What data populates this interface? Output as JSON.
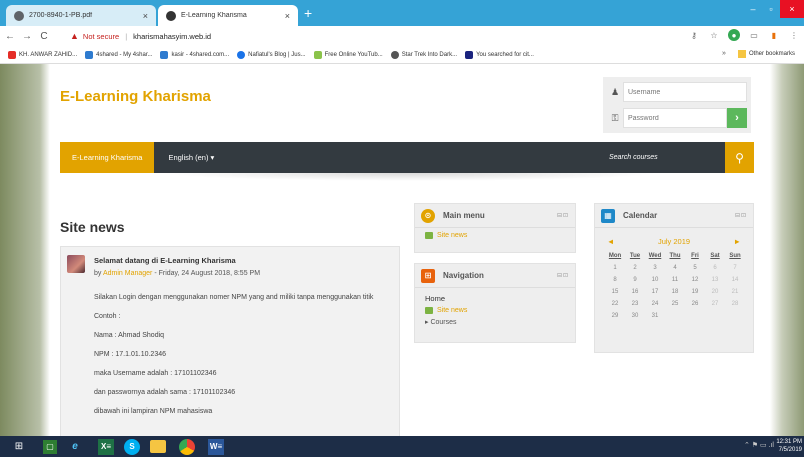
{
  "browser": {
    "tabs": [
      {
        "label": "2700-8940-1-PB.pdf",
        "close": "×"
      },
      {
        "label": "E-Learning Kharisma",
        "close": "×"
      }
    ],
    "new_tab": "+",
    "window": {
      "minimize": "–",
      "maximize": "▫",
      "close": "×"
    },
    "nav": {
      "back": "←",
      "forward": "→",
      "reload": "C"
    },
    "address": {
      "security": "Not secure",
      "separator": "|",
      "url": "kharismahasyim.web.id"
    },
    "bookmarks": [
      {
        "label": "KH. ANWAR ZAHID..."
      },
      {
        "label": "4shared - My 4shar..."
      },
      {
        "label": "kasir - 4shared.com..."
      },
      {
        "label": "Nafiatul's Blog | Jus..."
      },
      {
        "label": "Free Online YouTub..."
      },
      {
        "label": "Star Trek Into Dark..."
      },
      {
        "label": "You searched for cit..."
      }
    ],
    "bookmarks_more": "»",
    "other_bookmarks": "Other bookmarks"
  },
  "site": {
    "name": "E-Learning Kharisma",
    "login": {
      "username_placeholder": "Username",
      "password_placeholder": "Password",
      "go": "›"
    },
    "nav": {
      "home": "E-Learning Kharisma",
      "language": "English (en) ▾",
      "search": "Search courses"
    }
  },
  "news": {
    "heading": "Site news",
    "post": {
      "title": "Selamat datang di E-Learning Kharisma",
      "by_prefix": "by ",
      "author": "Admin Manager",
      "date": " - Friday, 24 August 2018, 8:55 PM",
      "lines": [
        "Silakan Login dengan menggunakan nomer NPM yang and miliki tanpa menggunakan titik",
        "Contoh :",
        "Nama : Ahmad Shodiq",
        "NPM : 17.1.01.10.2346",
        "maka Username adalah : 17101102346",
        "dan passwornya adalah sama : 17101102346",
        "dibawah ini lampiran NPM mahasiswa"
      ]
    }
  },
  "main_menu": {
    "title": "Main menu",
    "items": [
      "Site news"
    ],
    "controls": "⊟⊡"
  },
  "navigation": {
    "title": "Navigation",
    "home": "Home",
    "site_news": "Site news",
    "courses": "▸  Courses",
    "controls": "⊟⊡"
  },
  "calendar": {
    "title": "Calendar",
    "month": "July 2019",
    "prev": "◄",
    "next": "►",
    "controls": "⊟⊡",
    "days": [
      "Mon",
      "Tue",
      "Wed",
      "Thu",
      "Fri",
      "Sat",
      "Sun"
    ],
    "weeks": [
      [
        "1",
        "2",
        "3",
        "4",
        "5",
        "6",
        "7"
      ],
      [
        "8",
        "9",
        "10",
        "11",
        "12",
        "13",
        "14"
      ],
      [
        "15",
        "16",
        "17",
        "18",
        "19",
        "20",
        "21"
      ],
      [
        "22",
        "23",
        "24",
        "25",
        "26",
        "27",
        "28"
      ],
      [
        "29",
        "30",
        "31",
        "",
        "",
        "",
        ""
      ]
    ]
  },
  "taskbar": {
    "word_label": "W≡",
    "excel_label": "X≡",
    "skype_label": "S",
    "tray": "⌃  ⚑  ▭  .ıl",
    "time": "12:31 PM",
    "date": "7/5/2019"
  },
  "colors": {
    "accent": "#e2a300",
    "navbar": "#333a40",
    "chrome_blue": "#35a3d6",
    "taskbar": "#1d2d47"
  }
}
